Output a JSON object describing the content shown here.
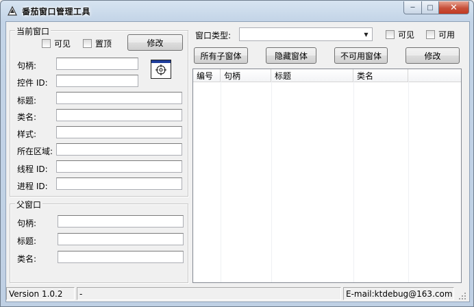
{
  "window": {
    "title": "番茄窗口管理工具"
  },
  "current_window": {
    "legend": "当前窗口",
    "visible_label": "可见",
    "topmost_label": "置顶",
    "modify_label": "修改",
    "fields": [
      {
        "label": "句柄:",
        "value": ""
      },
      {
        "label": "控件 ID:",
        "value": ""
      },
      {
        "label": "标题:",
        "value": ""
      },
      {
        "label": "类名:",
        "value": ""
      },
      {
        "label": "样式:",
        "value": ""
      },
      {
        "label": "所在区域:",
        "value": ""
      },
      {
        "label": "线程 ID:",
        "value": ""
      },
      {
        "label": "进程 ID:",
        "value": ""
      }
    ]
  },
  "parent_window": {
    "legend": "父窗口",
    "fields": [
      {
        "label": "句柄:",
        "value": ""
      },
      {
        "label": "标题:",
        "value": ""
      },
      {
        "label": "类名:",
        "value": ""
      }
    ]
  },
  "right_panel": {
    "window_type_label": "窗口类型:",
    "window_type_value": "",
    "visible_label": "可见",
    "usable_label": "可用",
    "buttons": {
      "all_children": "所有子窗体",
      "hidden": "隐藏窗体",
      "disabled": "不可用窗体",
      "modify": "修改"
    },
    "columns": [
      "编号",
      "句柄",
      "标题",
      "类名"
    ]
  },
  "status": {
    "version": "Version 1.0.2",
    "middle": "-",
    "email": "E-mail:ktdebug@163.com"
  },
  "colors": {
    "title_gradient_top": "#d7e4f1",
    "close_button": "#c7503a"
  }
}
